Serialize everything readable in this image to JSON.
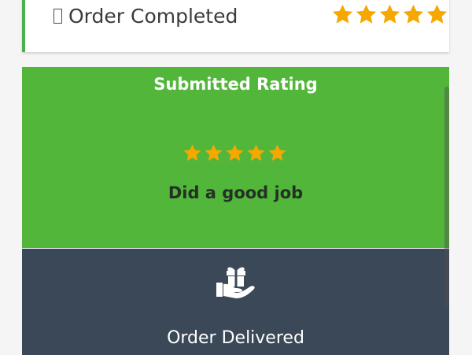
{
  "order_card": {
    "status_text": "Order Completed",
    "rating": 5,
    "rating_max": 5,
    "accent_color": "#4caf50",
    "star_color": "#f6a800",
    "icon": "missing-glyph-icon"
  },
  "rating_panel": {
    "title": "Submitted Rating",
    "rating": 5,
    "rating_max": 5,
    "comment": "Did a good job",
    "background_color": "#52b63b",
    "star_color": "#f6a800"
  },
  "delivered_panel": {
    "label": "Order Delivered",
    "icon": "gift-hand-icon",
    "background_color": "#3b4858"
  }
}
